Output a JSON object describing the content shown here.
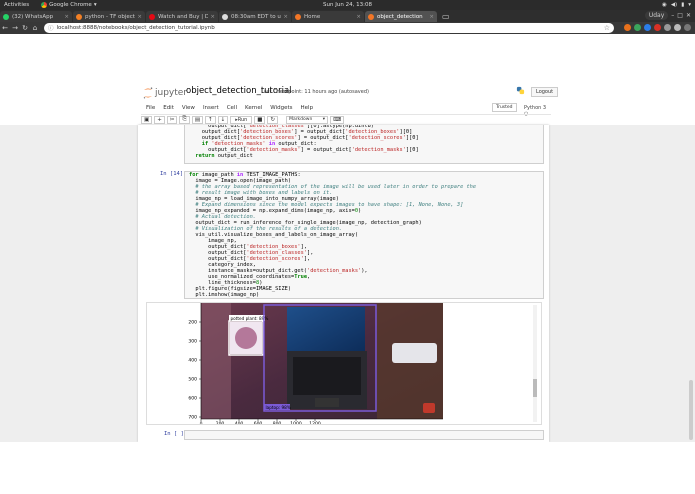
{
  "system_bar": {
    "activities": "Activities",
    "app_name": "Google Chrome",
    "clock": "Sun Jun 24, 13:08"
  },
  "browser": {
    "tabs": [
      {
        "title": "(32) WhatsApp",
        "icon_color": "#25d366",
        "active": false
      },
      {
        "title": "python - TF object",
        "icon_color": "#f48024",
        "active": false
      },
      {
        "title": "Watch and Buy | Dr",
        "icon_color": "#e50914",
        "active": false
      },
      {
        "title": "08:30am EDT to u",
        "icon_color": "#dddddd",
        "active": false
      },
      {
        "title": "Home",
        "icon_color": "#f37626",
        "active": false
      },
      {
        "title": "object_detection",
        "icon_color": "#f37626",
        "active": true
      }
    ],
    "profile": "Uday",
    "url": "localhost:8888/notebooks/object_detection_tutorial.ipynb"
  },
  "jupyter": {
    "logo_text": "jupyter",
    "notebook_name": "object_detection_tutorial",
    "checkpoint": "Last Checkpoint: 11 hours ago",
    "autosaved": "(autosaved)",
    "logout_label": "Logout",
    "menu": [
      "File",
      "Edit",
      "View",
      "Insert",
      "Cell",
      "Kernel",
      "Widgets",
      "Help"
    ],
    "trusted_label": "Trusted",
    "kernel_label": "Python 3",
    "run_label": "Run",
    "cell_type": "Markdown"
  },
  "cells": {
    "prompt_14": "In [14]:",
    "prompt_empty": "In [ ]:"
  },
  "plot": {
    "y_ticks": [
      "200",
      "300",
      "400",
      "500",
      "600",
      "700"
    ],
    "x_ticks": [
      "0",
      "200",
      "400",
      "600",
      "800",
      "1000",
      "1200"
    ],
    "detection_label_1": "potted plant: 89%",
    "detection_label_2": "laptop: 98%"
  },
  "colors": {
    "jupyter_orange": "#f37626",
    "prompt_blue": "#303f9f",
    "keyword_green": "#008000",
    "string_red": "#ba2121",
    "box_purple": "#7b5bd6",
    "box_white": "#ffffff"
  }
}
